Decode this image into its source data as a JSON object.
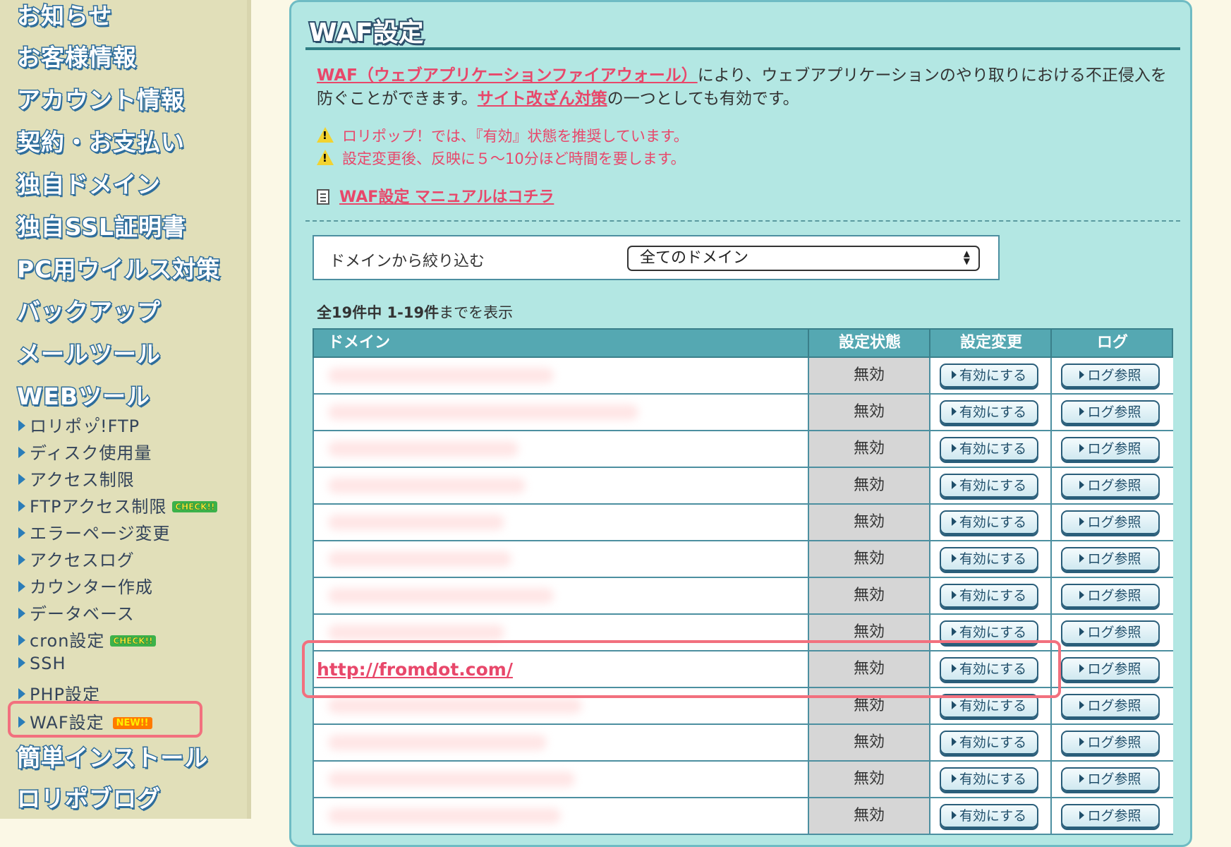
{
  "sidebar": {
    "main_items": [
      "お知らせ",
      "お客様情報",
      "アカウント情報",
      "契約・お支払い",
      "独自ドメイン",
      "独自SSL証明書",
      "PC用ウイルス対策",
      "バックアップ",
      "メールツール",
      "WEBツール"
    ],
    "sub_items": [
      {
        "label": "ロリポッ゚!FTP",
        "badge": ""
      },
      {
        "label": "ディスク使用量",
        "badge": ""
      },
      {
        "label": "アクセス制限",
        "badge": ""
      },
      {
        "label": "FTPアクセス制限",
        "badge": "CHECK!!"
      },
      {
        "label": "エラーページ変更",
        "badge": ""
      },
      {
        "label": "アクセスログ",
        "badge": ""
      },
      {
        "label": "カウンター作成",
        "badge": ""
      },
      {
        "label": "データベース",
        "badge": ""
      },
      {
        "label": "cron設定",
        "badge": "CHECK!!"
      },
      {
        "label": "SSH",
        "badge": ""
      },
      {
        "label": "PHP設定",
        "badge": ""
      },
      {
        "label": "WAF設定",
        "badge": "NEW!!"
      }
    ],
    "bottom_items": [
      "簡単インストール",
      "ロリポブログ"
    ]
  },
  "page": {
    "title": "WAF設定",
    "intro_link1": "WAF（ウェブアプリケーションファイアウォール）",
    "intro_text1": "により、ウェブアプリケーションのやり取りにおける不正侵入を防ぐことができます。",
    "intro_link2": "サイト改ざん対策",
    "intro_text2": "の一つとしても有効です。",
    "warning1": "ロリポップ！では、『有効』状態を推奨しています。",
    "warning2": "設定変更後、反映に５〜10分ほど時間を要します。",
    "manual_link": "WAF設定 マニュアルはコチラ"
  },
  "filter": {
    "label": "ドメインから絞り込む",
    "selected": "全てのドメイン"
  },
  "count": {
    "bold": "全19件中 1-19件",
    "rest": "までを表示"
  },
  "table": {
    "headers": [
      "ドメイン",
      "設定状態",
      "設定変更",
      "ログ"
    ],
    "enable_label": "有効にする",
    "log_label": "ログ参照",
    "rows": [
      {
        "domain": "",
        "status": "無効"
      },
      {
        "domain": "",
        "status": "無効"
      },
      {
        "domain": "",
        "status": "無効"
      },
      {
        "domain": "",
        "status": "無効"
      },
      {
        "domain": "",
        "status": "無効"
      },
      {
        "domain": "",
        "status": "無効"
      },
      {
        "domain": "",
        "status": "無効"
      },
      {
        "domain": "",
        "status": "無効"
      },
      {
        "domain": "http://fromdot.com/",
        "status": "無効"
      },
      {
        "domain": "",
        "status": "無効"
      },
      {
        "domain": "",
        "status": "無効"
      },
      {
        "domain": "",
        "status": "無効"
      },
      {
        "domain": "",
        "status": "無効"
      }
    ]
  },
  "colors": {
    "panel_bg": "#b3e7e3",
    "sidebar_bg": "#e1dfb9",
    "link_pink": "#e8476a",
    "header_teal": "#55a8b2",
    "highlight_red": "#f2707e"
  }
}
